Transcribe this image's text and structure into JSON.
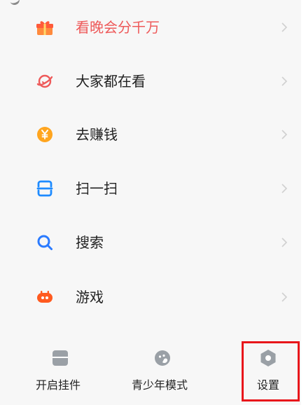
{
  "menu": {
    "items": [
      {
        "label": "看晚会分千万",
        "icon": "gift-icon"
      },
      {
        "label": "大家都在看",
        "icon": "planet-icon"
      },
      {
        "label": "去赚钱",
        "icon": "yuan-coin-icon"
      },
      {
        "label": "扫一扫",
        "icon": "scan-icon"
      },
      {
        "label": "搜索",
        "icon": "search-icon"
      },
      {
        "label": "游戏",
        "icon": "gamepad-icon"
      }
    ]
  },
  "bottom": {
    "items": [
      {
        "label": "开启挂件",
        "icon": "widget-icon"
      },
      {
        "label": "青少年模式",
        "icon": "teen-mode-icon"
      },
      {
        "label": "设置",
        "icon": "settings-hexagon-icon"
      }
    ]
  },
  "colors": {
    "accent_red": "#ee5a5a",
    "gift_orange": "#ff6b3d",
    "coin_orange": "#ffa51f",
    "scan_blue": "#1e8bff",
    "search_blue": "#2b7bff",
    "game_orange": "#ff5a1f",
    "highlight_red": "#e8161b",
    "muted_icon": "#9aa0a6"
  }
}
